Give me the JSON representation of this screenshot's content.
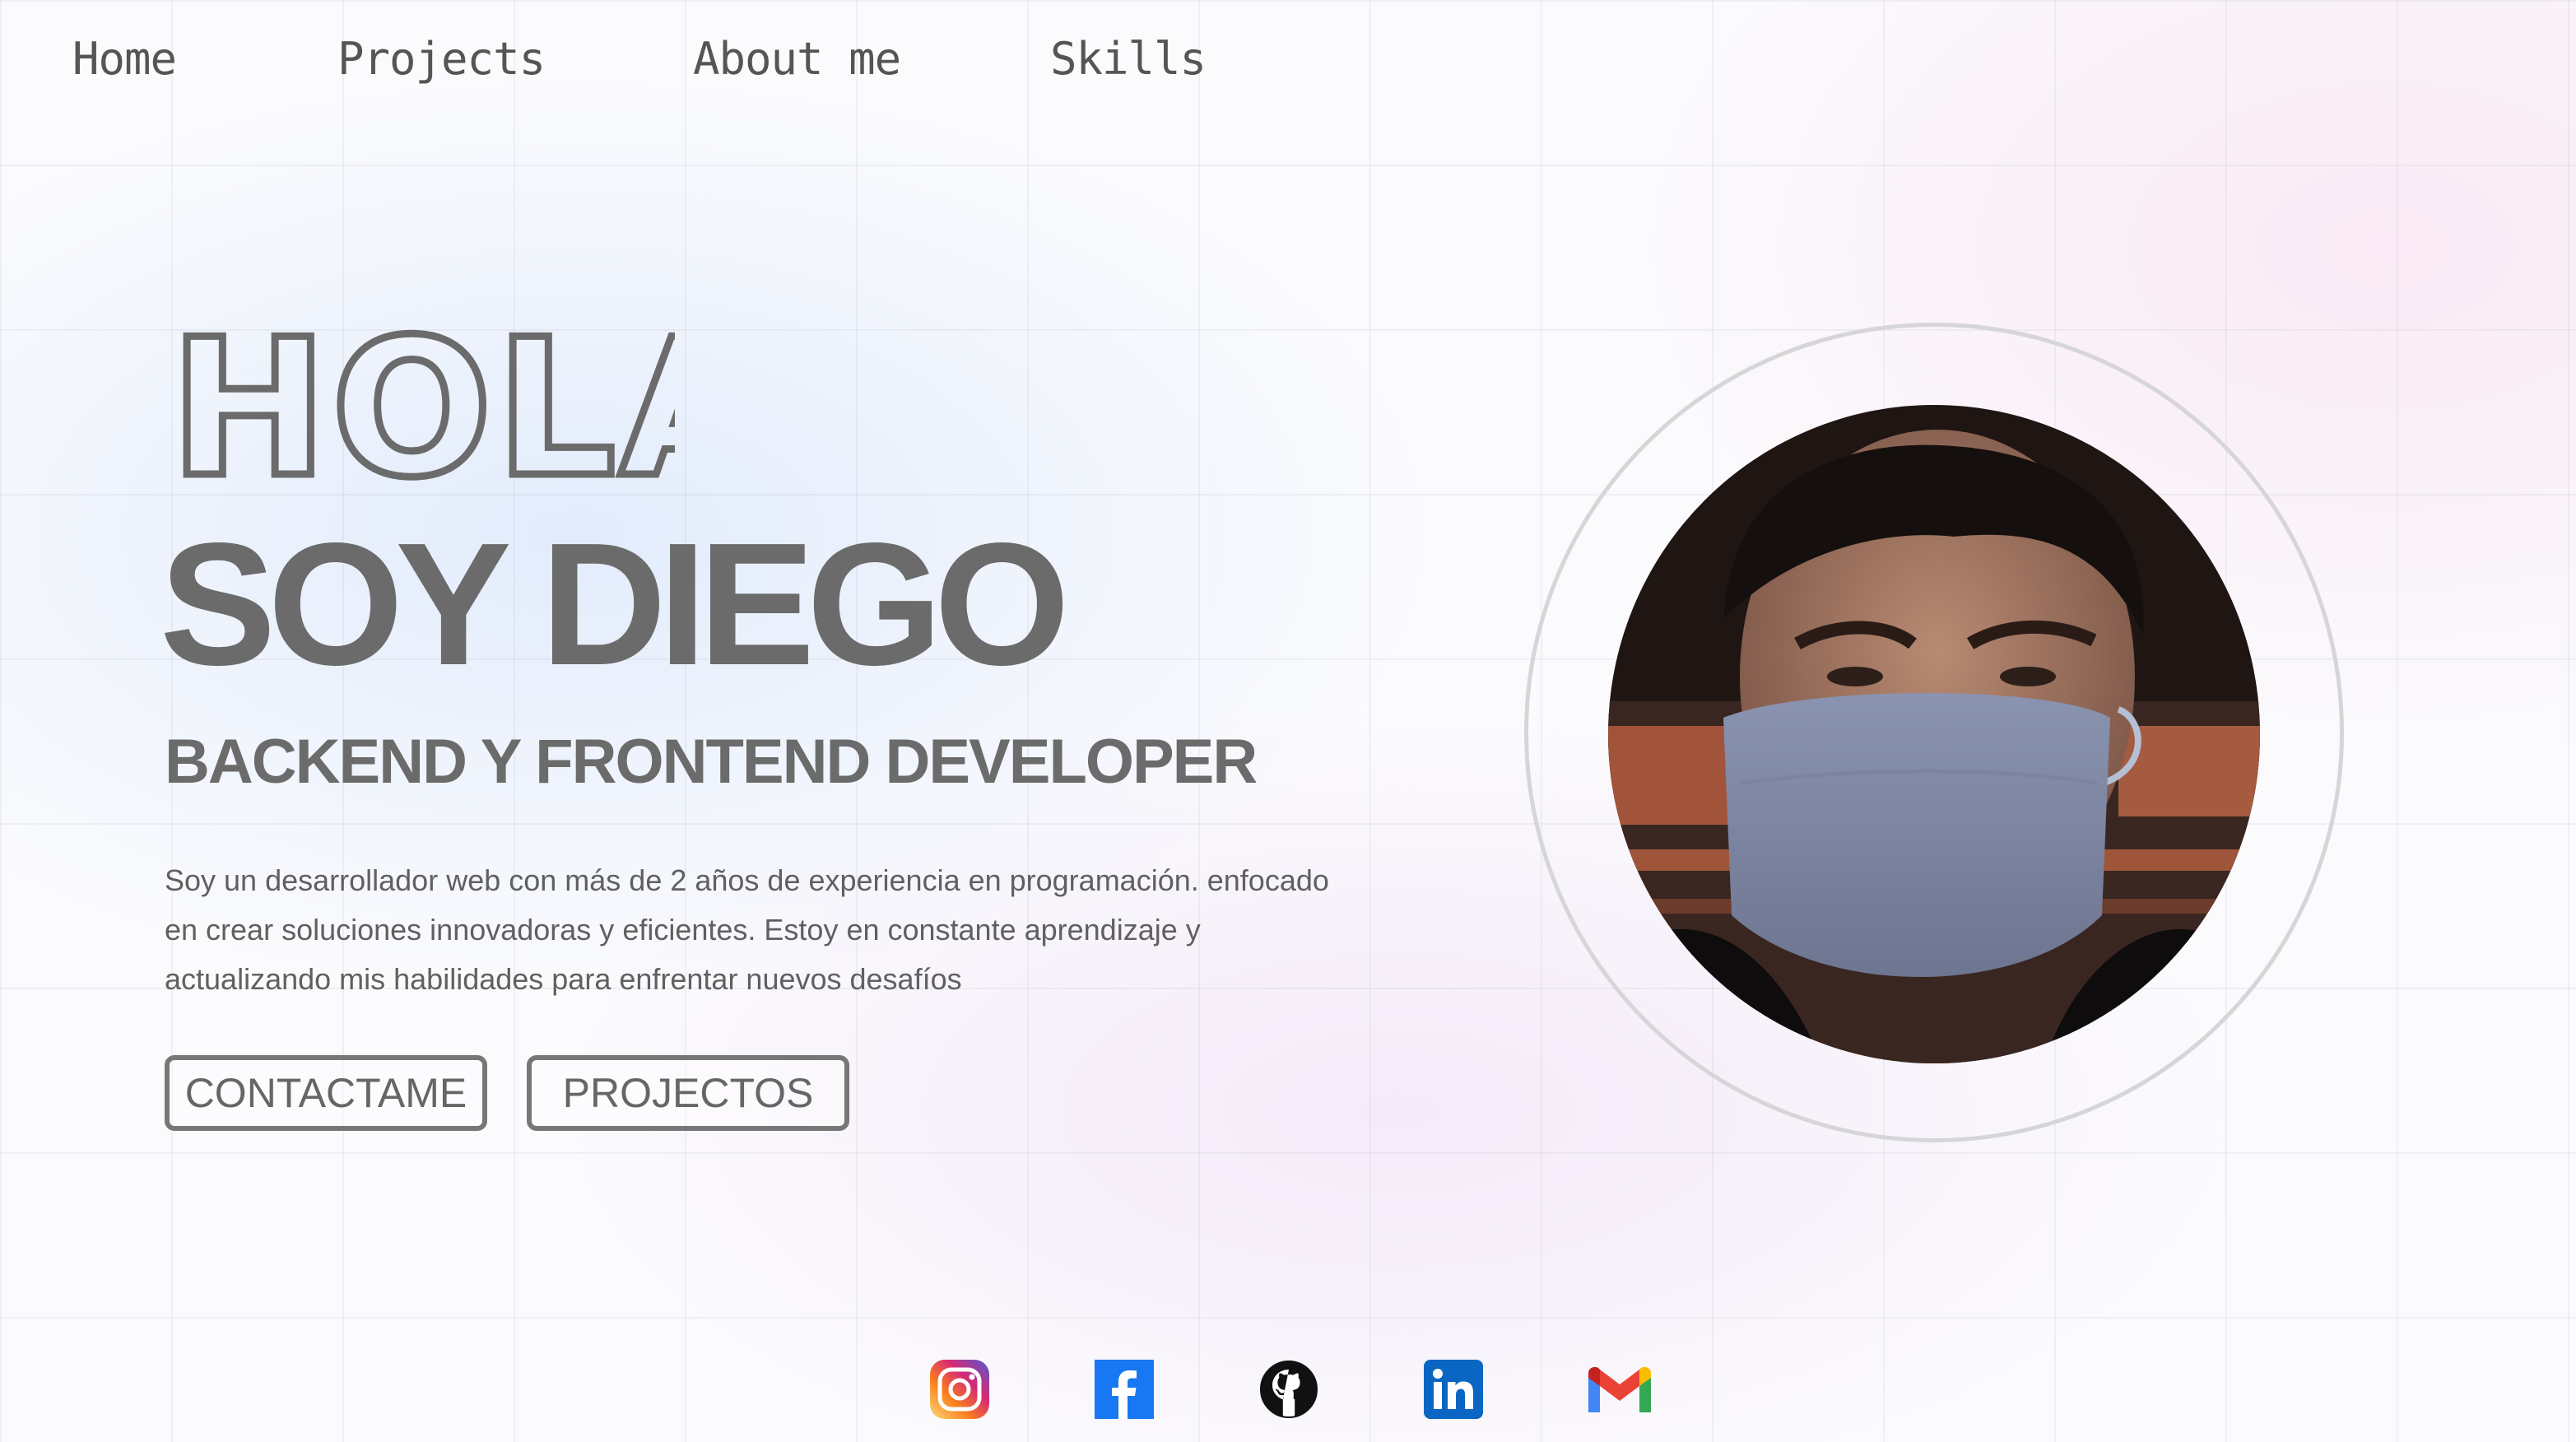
{
  "nav": {
    "items": [
      {
        "label": "Home"
      },
      {
        "label": "Projects"
      },
      {
        "label": "About me"
      },
      {
        "label": "Skills"
      }
    ]
  },
  "hero": {
    "greeting": "HOLA",
    "name": "SOY DIEGO",
    "role": "BACKEND Y FRONTEND DEVELOPER",
    "bio": "Soy un desarrollador web con más de 2 años de experiencia en programación. enfocado en crear soluciones innovadoras y eficientes. Estoy en constante aprendizaje y actualizando mis habilidades para enfrentar nuevos desafíos",
    "buttons": {
      "contact": "CONTACTAME",
      "projects": "PROJECTOS"
    }
  },
  "social": {
    "icons": [
      "instagram-icon",
      "facebook-icon",
      "github-icon",
      "linkedin-icon",
      "gmail-icon"
    ]
  },
  "colors": {
    "text": "#6b6b6b",
    "facebook": "#1877f2",
    "linkedin": "#0a66c2"
  }
}
